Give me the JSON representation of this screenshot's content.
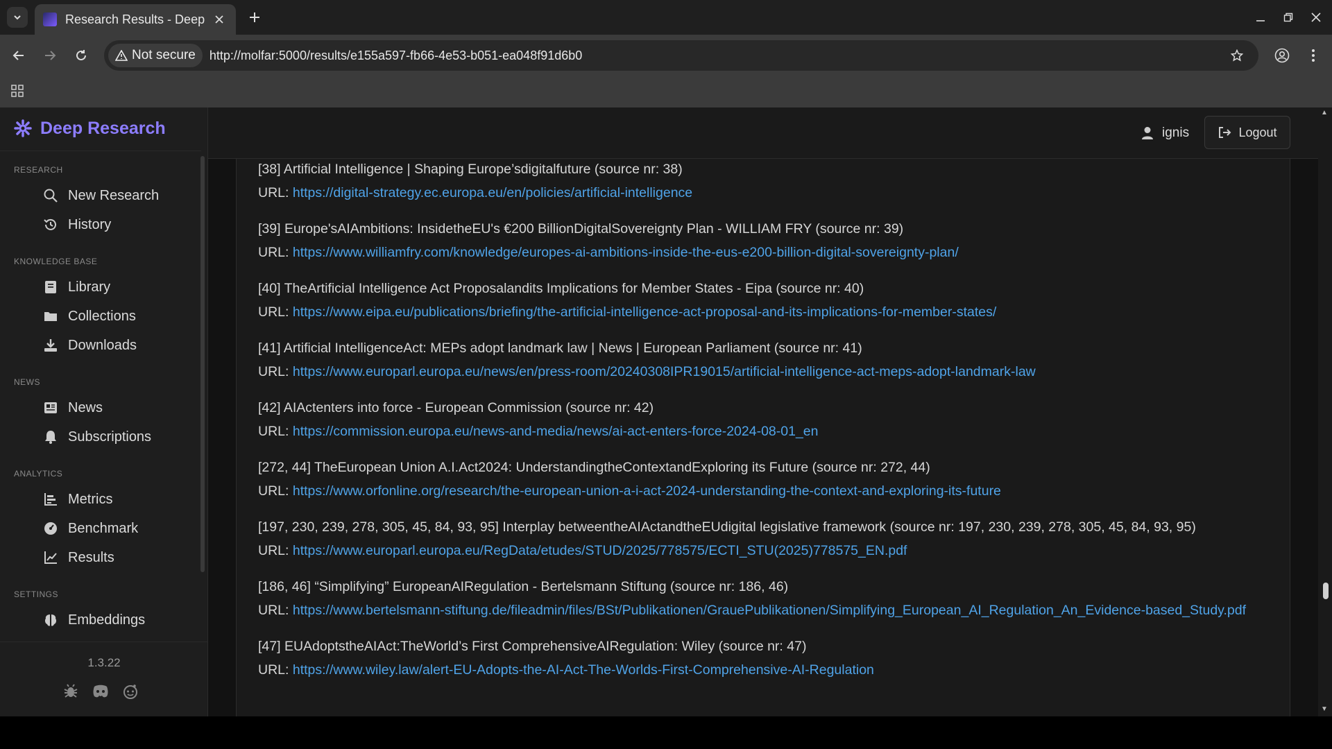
{
  "browser": {
    "tab_title": "Research Results - Deep",
    "not_secure_label": "Not secure",
    "url": "http://molfar:5000/results/e155a597-fb66-4e53-b051-ea048f91d6b0"
  },
  "app": {
    "brand": "Deep Research",
    "version": "1.3.22",
    "user_name": "ignis",
    "logout_label": "Logout"
  },
  "sidebar": {
    "sections": [
      {
        "label": "RESEARCH",
        "items": [
          {
            "label": "New Research",
            "icon": "search-icon"
          },
          {
            "label": "History",
            "icon": "history-icon"
          }
        ]
      },
      {
        "label": "KNOWLEDGE BASE",
        "items": [
          {
            "label": "Library",
            "icon": "book-icon"
          },
          {
            "label": "Collections",
            "icon": "folder-icon"
          },
          {
            "label": "Downloads",
            "icon": "download-icon"
          }
        ]
      },
      {
        "label": "NEWS",
        "items": [
          {
            "label": "News",
            "icon": "newspaper-icon"
          },
          {
            "label": "Subscriptions",
            "icon": "bell-icon"
          }
        ]
      },
      {
        "label": "ANALYTICS",
        "items": [
          {
            "label": "Metrics",
            "icon": "bar-chart-icon"
          },
          {
            "label": "Benchmark",
            "icon": "gauge-icon"
          },
          {
            "label": "Results",
            "icon": "line-chart-icon"
          }
        ]
      },
      {
        "label": "SETTINGS",
        "items": [
          {
            "label": "Embeddings",
            "icon": "brain-icon"
          }
        ]
      }
    ]
  },
  "sources": [
    {
      "title": "[38] Artificial Intelligence | Shaping Europe’sdigitalfuture (source nr: 38)",
      "url_label": "URL:",
      "url": "https://digital-strategy.ec.europa.eu/en/policies/artificial-intelligence"
    },
    {
      "title": "[39] Europe'sAIAmbitions: InsidetheEU's €200 BillionDigitalSovereignty Plan - WILLIAM FRY (source nr: 39)",
      "url_label": "URL:",
      "url": "https://www.williamfry.com/knowledge/europes-ai-ambitions-inside-the-eus-e200-billion-digital-sovereignty-plan/"
    },
    {
      "title": "[40] TheArtificial Intelligence Act Proposalandits Implications for Member States - Eipa (source nr: 40)",
      "url_label": "URL:",
      "url": "https://www.eipa.eu/publications/briefing/the-artificial-intelligence-act-proposal-and-its-implications-for-member-states/"
    },
    {
      "title": "[41] Artificial IntelligenceAct: MEPs adopt landmark law | News | European Parliament (source nr: 41)",
      "url_label": "URL:",
      "url": "https://www.europarl.europa.eu/news/en/press-room/20240308IPR19015/artificial-intelligence-act-meps-adopt-landmark-law"
    },
    {
      "title": "[42] AIActenters into force - European Commission (source nr: 42)",
      "url_label": "URL:",
      "url": "https://commission.europa.eu/news-and-media/news/ai-act-enters-force-2024-08-01_en"
    },
    {
      "title": "[272, 44] TheEuropean Union A.I.Act2024: UnderstandingtheContextandExploring its Future (source nr: 272, 44)",
      "url_label": "URL:",
      "url": "https://www.orfonline.org/research/the-european-union-a-i-act-2024-understanding-the-context-and-exploring-its-future"
    },
    {
      "title": "[197, 230, 239, 278, 305, 45, 84, 93, 95] Interplay betweentheAIActandtheEUdigital legislative framework (source nr: 197, 230, 239, 278, 305, 45, 84, 93, 95)",
      "url_label": "URL:",
      "url": "https://www.europarl.europa.eu/RegData/etudes/STUD/2025/778575/ECTI_STU(2025)778575_EN.pdf"
    },
    {
      "title": "[186, 46] “Simplifying” EuropeanAIRegulation - Bertelsmann Stiftung (source nr: 186, 46)",
      "url_label": "URL:",
      "url": "https://www.bertelsmann-stiftung.de/fileadmin/files/BSt/Publikationen/GrauePublikationen/Simplifying_European_AI_Regulation_An_Evidence-based_Study.pdf"
    },
    {
      "title": "[47] EUAdoptstheAIAct:TheWorld’s First ComprehensiveAIRegulation: Wiley (source nr: 47)",
      "url_label": "URL:",
      "url": "https://www.wiley.law/alert-EU-Adopts-the-AI-Act-The-Worlds-First-Comprehensive-AI-Regulation"
    }
  ]
}
